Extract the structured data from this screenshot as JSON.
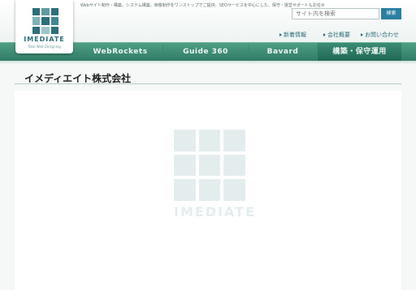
{
  "header": {
    "tagline": "Webサイト制作・構築、システム構築、映像制作をワンストップでご提供。SEOサービスを中心にした、保守・運営サポートもお任せください。",
    "logo_text": "IMEDIATE",
    "logo_subtext": "Total Web Designing",
    "search_placeholder": "サイト内を検索",
    "search_button": "検索",
    "subnav": [
      "新着情報",
      "会社概要",
      "お問い合わせ"
    ]
  },
  "nav": {
    "items": [
      "WebRockets",
      "Guide 360",
      "Bavard",
      "構築・保守運用"
    ]
  },
  "main": {
    "page_title": "イメディエイト株式会社",
    "watermark_text": "IMEDIATE"
  },
  "colors": {
    "nav_green": "#2e7a65",
    "link_teal": "#2e6e7a",
    "search_blue": "#2b7fa2"
  }
}
